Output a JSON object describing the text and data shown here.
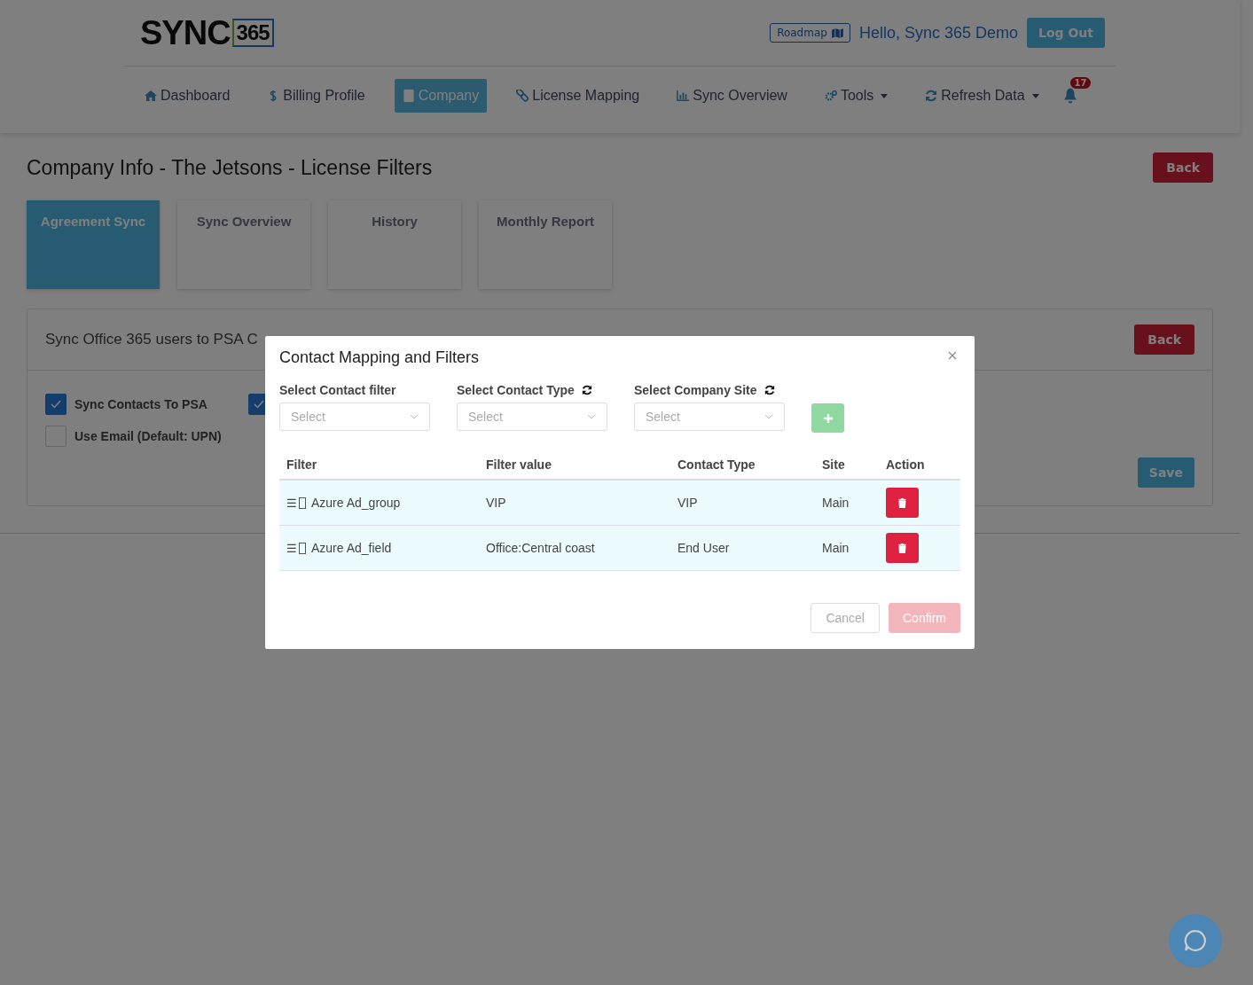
{
  "header": {
    "logo": {
      "word": "SYNC",
      "number": "365"
    },
    "roadmap": "Roadmap",
    "greeting": "Hello, Sync 365 Demo",
    "logout": "Log Out"
  },
  "nav": [
    {
      "label": "Dashboard",
      "selected": false,
      "dropdown": false
    },
    {
      "label": "Billing Profile",
      "selected": false,
      "dropdown": false
    },
    {
      "label": "Company",
      "selected": true,
      "dropdown": false
    },
    {
      "label": "License Mapping",
      "selected": false,
      "dropdown": false
    },
    {
      "label": "Sync Overview",
      "selected": false,
      "dropdown": false
    },
    {
      "label": "Tools",
      "selected": false,
      "dropdown": true
    },
    {
      "label": "Refresh Data",
      "selected": false,
      "dropdown": true
    }
  ],
  "notifications": {
    "count": "17"
  },
  "page": {
    "title": "Company Info - The Jetsons - License Filters",
    "back": "Back"
  },
  "tabs": [
    {
      "label": "Agreement Sync",
      "selected": true
    },
    {
      "label": "Sync Overview",
      "selected": false
    },
    {
      "label": "History",
      "selected": false
    },
    {
      "label": "Monthly Report",
      "selected": false
    }
  ],
  "panel": {
    "title": "Sync Office 365 users to PSA C",
    "back": "Back",
    "save": "Save",
    "options": [
      {
        "label": "Sync Contacts To PSA",
        "checked": true
      },
      {
        "checked": true
      },
      {
        "label": "Use Email (Default: UPN)",
        "checked": false
      }
    ]
  },
  "modal": {
    "title": "Contact Mapping and Filters",
    "selects": [
      {
        "label": "Select Contact filter",
        "placeholder": "Select",
        "refresh": false
      },
      {
        "label": "Select Contact Type",
        "placeholder": "Select",
        "refresh": true
      },
      {
        "label": "Select Company Site",
        "placeholder": "Select",
        "refresh": true
      }
    ],
    "columns": [
      "Filter",
      "Filter value",
      "Contact Type",
      "Site",
      "Action"
    ],
    "rows": [
      {
        "handle": "☰",
        "filter": "Azure Ad_group",
        "value": "VIP",
        "contact_type": "VIP",
        "site": "Main"
      },
      {
        "handle": "☰",
        "filter": "Azure Ad_field",
        "value": "Office:Central coast",
        "contact_type": "End User",
        "site": "Main"
      }
    ],
    "cancel": "Cancel",
    "confirm": "Confirm"
  }
}
